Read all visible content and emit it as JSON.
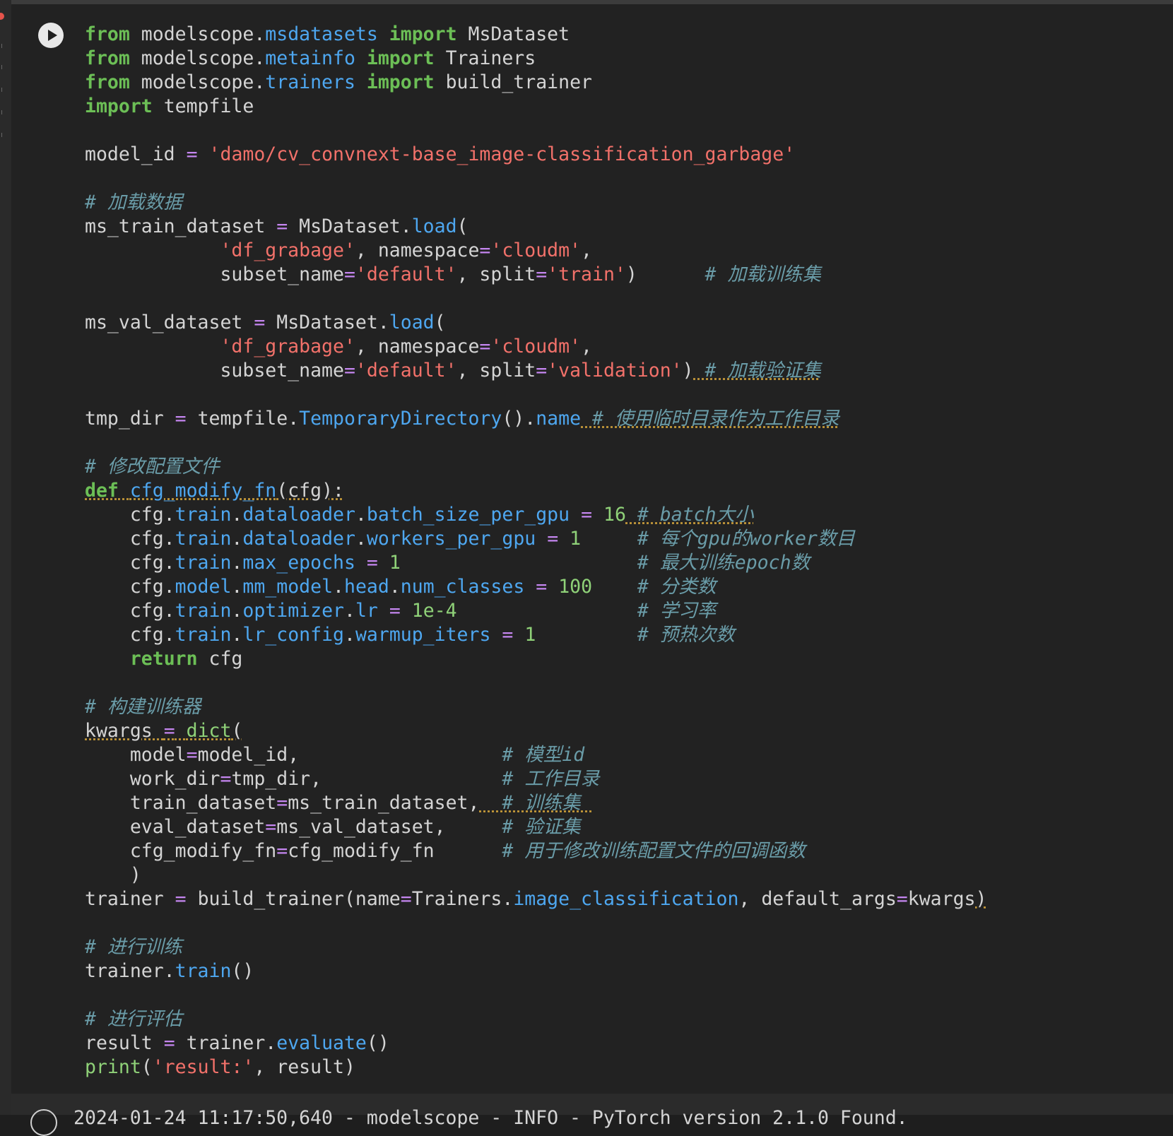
{
  "run_button": {
    "icon": "play-icon"
  },
  "code_lines": [
    "from modelscope.msdatasets import MsDataset",
    "from modelscope.metainfo import Trainers",
    "from modelscope.trainers import build_trainer",
    "import tempfile",
    "",
    "model_id = 'damo/cv_convnext-base_image-classification_garbage'",
    "",
    "# 加载数据",
    "ms_train_dataset = MsDataset.load(",
    "            'df_grabage', namespace='cloudm',",
    "            subset_name='default', split='train')      # 加载训练集",
    "",
    "ms_val_dataset = MsDataset.load(",
    "            'df_grabage', namespace='cloudm',",
    "            subset_name='default', split='validation') # 加载验证集",
    "",
    "tmp_dir = tempfile.TemporaryDirectory().name # 使用临时目录作为工作目录",
    "",
    "# 修改配置文件",
    "def cfg_modify_fn(cfg):",
    "    cfg.train.dataloader.batch_size_per_gpu = 16 # batch大小",
    "    cfg.train.dataloader.workers_per_gpu = 1     # 每个gpu的worker数目",
    "    cfg.train.max_epochs = 1                     # 最大训练epoch数",
    "    cfg.model.mm_model.head.num_classes = 100    # 分类数",
    "    cfg.train.optimizer.lr = 1e-4                # 学习率",
    "    cfg.train.lr_config.warmup_iters = 1         # 预热次数",
    "    return cfg",
    "",
    "# 构建训练器",
    "kwargs = dict(",
    "    model=model_id,                  # 模型id",
    "    work_dir=tmp_dir,                # 工作目录",
    "    train_dataset=ms_train_dataset,  # 训练集",
    "    eval_dataset=ms_val_dataset,     # 验证集",
    "    cfg_modify_fn=cfg_modify_fn      # 用于修改训练配置文件的回调函数",
    "    )",
    "trainer = build_trainer(name=Trainers.image_classification, default_args=kwargs)",
    "",
    "# 进行训练",
    "trainer.train()",
    "",
    "# 进行评估",
    "result = trainer.evaluate()",
    "print('result:', result)"
  ],
  "output_preview": "2024-01-24 11:17:50,640 - modelscope - INFO - PyTorch version 2.1.0 Found."
}
